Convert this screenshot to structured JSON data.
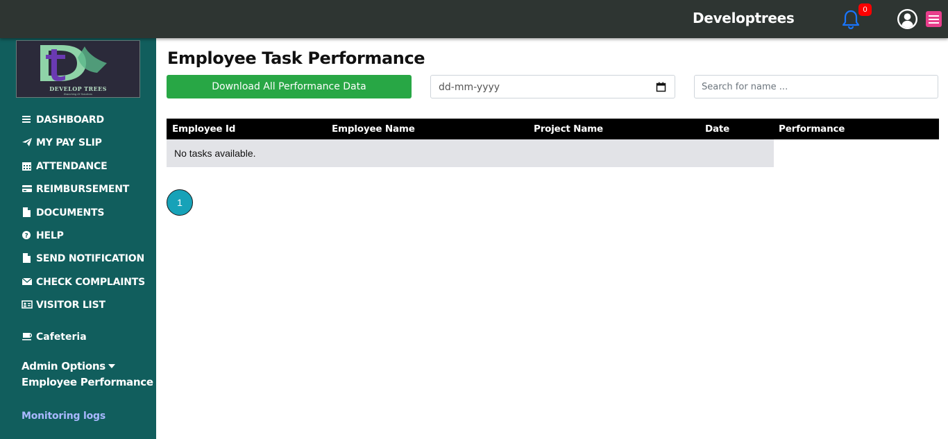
{
  "header": {
    "brand": "Developtrees",
    "notification_count": "0"
  },
  "sidebar": {
    "logo": {
      "text": "DEVELOP TREES",
      "tagline": "Branching Of Solutions"
    },
    "items": [
      {
        "label": "DASHBOARD",
        "icon": "bars-icon"
      },
      {
        "label": "MY PAY SLIP",
        "icon": "paper-plane-icon"
      },
      {
        "label": "ATTENDANCE",
        "icon": "calendar-icon"
      },
      {
        "label": "REIMBURSEMENT",
        "icon": "credit-card-icon"
      },
      {
        "label": "DOCUMENTS",
        "icon": "file-icon"
      },
      {
        "label": "HELP",
        "icon": "question-circle-icon"
      },
      {
        "label": "SEND NOTIFICATION",
        "icon": "file-icon"
      },
      {
        "label": "CHECK COMPLAINTS",
        "icon": "envelope-icon"
      },
      {
        "label": "VISITOR LIST",
        "icon": "id-card-icon"
      },
      {
        "label": "Cafeteria",
        "icon": "coffee-icon"
      }
    ],
    "dropdowns": [
      {
        "label": "Admin Options"
      },
      {
        "label": "Employee Performance"
      }
    ],
    "monitoring": "Monitoring logs"
  },
  "main": {
    "title": "Employee Task Performance",
    "download_label": "Download All Performance Data",
    "date_placeholder": "dd-mm-yyyy",
    "search_placeholder": "Search for name ...",
    "table": {
      "columns": [
        "Employee Id",
        "Employee Name",
        "Project Name",
        "Date",
        "Performance"
      ],
      "empty_message": "No tasks available."
    },
    "pagination": {
      "current_page": "1"
    }
  },
  "colors": {
    "topbar": "#2e3532",
    "sidebar": "#115e5d",
    "download_button": "#28a745",
    "page_button": "#17a2b8",
    "menu_button": "#e83e8c",
    "badge": "#ff0000",
    "bell": "#1976ff"
  }
}
